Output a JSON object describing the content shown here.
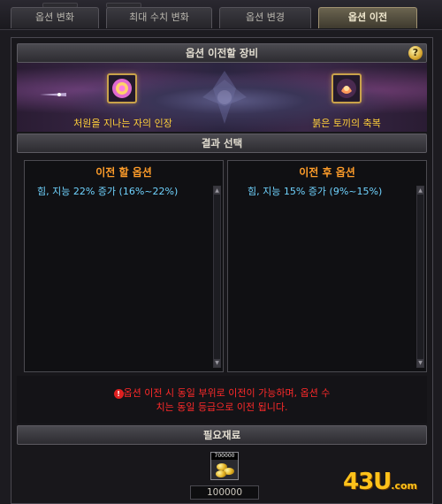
{
  "tabs": [
    {
      "label": "옵션 변화",
      "active": false
    },
    {
      "label": "최대 수치 변화",
      "active": false
    },
    {
      "label": "옵션 변경",
      "active": false
    },
    {
      "label": "옵션 이전",
      "active": true
    }
  ],
  "equipment_section": {
    "title": "옵션 이전할 장비",
    "help_icon": "question-icon",
    "help_glyph": "?",
    "items": [
      {
        "name": "처원을 지나는 자의 인장",
        "icon": "seal-icon"
      },
      {
        "name": "붉은 토끼의 축복",
        "icon": "rabbit-blessing-icon"
      }
    ]
  },
  "result_section": {
    "title": "결과 선택",
    "before": {
      "title": "이전 할 옵션",
      "options": [
        "힘, 지능 22% 증가 (16%~22%)"
      ]
    },
    "after": {
      "title": "이전 후 옵션",
      "options": [
        "힘, 지능 15% 증가 (9%~15%)"
      ]
    }
  },
  "notice": {
    "line1": "옵션 이전 시 동일 부위로 이전이 가능하며, 옵션 수",
    "line2": "치는 동일 등급으로 이전 됩니다.",
    "icon_glyph": "!"
  },
  "materials": {
    "title": "필요재료",
    "item_badge": "700000",
    "count": "100000"
  },
  "watermark": {
    "main": "43U",
    "suffix": ".com"
  },
  "colors": {
    "accent_gold": "#ffcf3a",
    "option_cyan": "#6fd3ff",
    "list_title_orange": "#ff9d2a",
    "notice_red": "#ff2a2a"
  }
}
